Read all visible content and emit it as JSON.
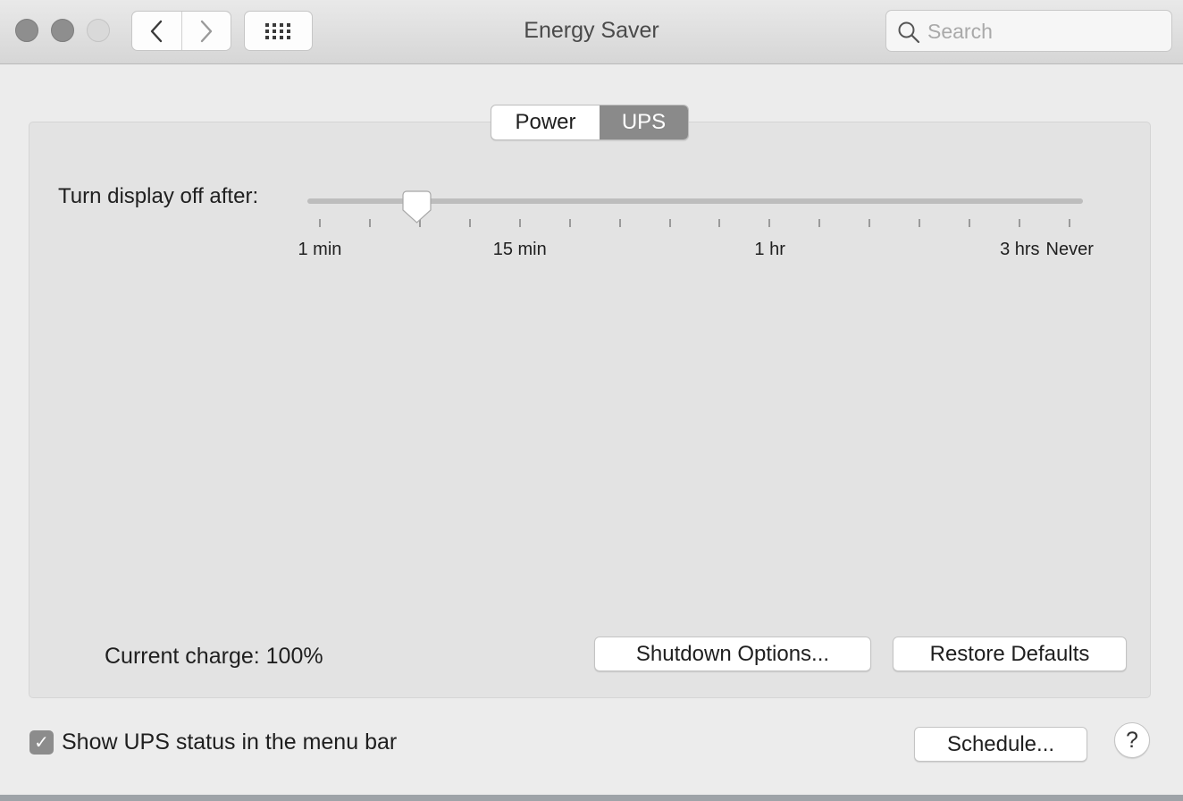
{
  "window": {
    "title": "Energy Saver",
    "search_placeholder": "Search",
    "icons": {
      "back": "chevron-left-icon",
      "forward": "chevron-right-icon",
      "grid": "grid-icon",
      "search": "magnifier-icon"
    }
  },
  "tabs": [
    {
      "label": "Power",
      "active": false
    },
    {
      "label": "UPS",
      "active": true
    }
  ],
  "display_slider": {
    "label": "Turn display off after:",
    "tick_count": 16,
    "selected_tick_fraction": 0.129,
    "tick_labels": [
      {
        "text": "1 min",
        "tick_index": 0
      },
      {
        "text": "15 min",
        "tick_index": 4
      },
      {
        "text": "1 hr",
        "tick_index": 9
      },
      {
        "text": "3 hrs",
        "tick_index": 14
      },
      {
        "text": "Never",
        "tick_index": 15
      }
    ]
  },
  "status": {
    "current_charge": "Current charge: 100%"
  },
  "buttons": {
    "shutdown_options": "Shutdown Options...",
    "restore_defaults": "Restore Defaults",
    "schedule": "Schedule...",
    "help": "?"
  },
  "menu_bar_option": {
    "label": "Show UPS status in the menu bar",
    "checked": true,
    "check_glyph": "✓"
  },
  "colors": {
    "active_tab": "#8a8a8a",
    "checkbox": "#8c8c8c"
  }
}
